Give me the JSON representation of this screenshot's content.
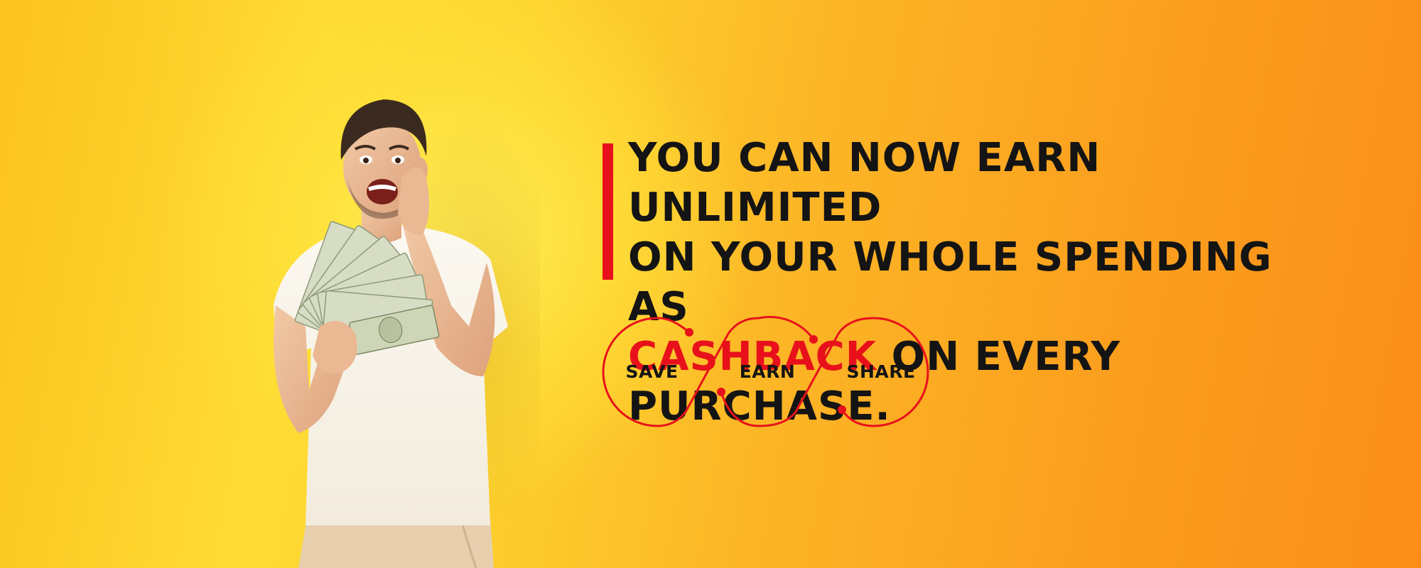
{
  "headline": {
    "line1": "You can now earn unlimited",
    "line2": "on your whole spending as",
    "highlight": "cashback",
    "line3_rest": " on every purchase."
  },
  "steps": [
    {
      "label": "SAVE"
    },
    {
      "label": "EARN"
    },
    {
      "label": "SHARE"
    }
  ],
  "colors": {
    "accent": "#e8111b",
    "text": "#141414",
    "background_left": "#fcc21e",
    "background_right": "#fa8d18"
  }
}
